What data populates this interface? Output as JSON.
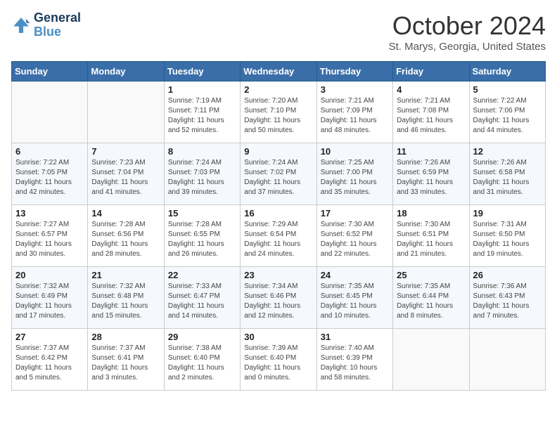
{
  "logo": {
    "line1": "General",
    "line2": "Blue"
  },
  "title": "October 2024",
  "subtitle": "St. Marys, Georgia, United States",
  "headers": [
    "Sunday",
    "Monday",
    "Tuesday",
    "Wednesday",
    "Thursday",
    "Friday",
    "Saturday"
  ],
  "weeks": [
    [
      {
        "day": "",
        "sunrise": "",
        "sunset": "",
        "daylight": ""
      },
      {
        "day": "",
        "sunrise": "",
        "sunset": "",
        "daylight": ""
      },
      {
        "day": "1",
        "sunrise": "Sunrise: 7:19 AM",
        "sunset": "Sunset: 7:11 PM",
        "daylight": "Daylight: 11 hours and 52 minutes."
      },
      {
        "day": "2",
        "sunrise": "Sunrise: 7:20 AM",
        "sunset": "Sunset: 7:10 PM",
        "daylight": "Daylight: 11 hours and 50 minutes."
      },
      {
        "day": "3",
        "sunrise": "Sunrise: 7:21 AM",
        "sunset": "Sunset: 7:09 PM",
        "daylight": "Daylight: 11 hours and 48 minutes."
      },
      {
        "day": "4",
        "sunrise": "Sunrise: 7:21 AM",
        "sunset": "Sunset: 7:08 PM",
        "daylight": "Daylight: 11 hours and 46 minutes."
      },
      {
        "day": "5",
        "sunrise": "Sunrise: 7:22 AM",
        "sunset": "Sunset: 7:06 PM",
        "daylight": "Daylight: 11 hours and 44 minutes."
      }
    ],
    [
      {
        "day": "6",
        "sunrise": "Sunrise: 7:22 AM",
        "sunset": "Sunset: 7:05 PM",
        "daylight": "Daylight: 11 hours and 42 minutes."
      },
      {
        "day": "7",
        "sunrise": "Sunrise: 7:23 AM",
        "sunset": "Sunset: 7:04 PM",
        "daylight": "Daylight: 11 hours and 41 minutes."
      },
      {
        "day": "8",
        "sunrise": "Sunrise: 7:24 AM",
        "sunset": "Sunset: 7:03 PM",
        "daylight": "Daylight: 11 hours and 39 minutes."
      },
      {
        "day": "9",
        "sunrise": "Sunrise: 7:24 AM",
        "sunset": "Sunset: 7:02 PM",
        "daylight": "Daylight: 11 hours and 37 minutes."
      },
      {
        "day": "10",
        "sunrise": "Sunrise: 7:25 AM",
        "sunset": "Sunset: 7:00 PM",
        "daylight": "Daylight: 11 hours and 35 minutes."
      },
      {
        "day": "11",
        "sunrise": "Sunrise: 7:26 AM",
        "sunset": "Sunset: 6:59 PM",
        "daylight": "Daylight: 11 hours and 33 minutes."
      },
      {
        "day": "12",
        "sunrise": "Sunrise: 7:26 AM",
        "sunset": "Sunset: 6:58 PM",
        "daylight": "Daylight: 11 hours and 31 minutes."
      }
    ],
    [
      {
        "day": "13",
        "sunrise": "Sunrise: 7:27 AM",
        "sunset": "Sunset: 6:57 PM",
        "daylight": "Daylight: 11 hours and 30 minutes."
      },
      {
        "day": "14",
        "sunrise": "Sunrise: 7:28 AM",
        "sunset": "Sunset: 6:56 PM",
        "daylight": "Daylight: 11 hours and 28 minutes."
      },
      {
        "day": "15",
        "sunrise": "Sunrise: 7:28 AM",
        "sunset": "Sunset: 6:55 PM",
        "daylight": "Daylight: 11 hours and 26 minutes."
      },
      {
        "day": "16",
        "sunrise": "Sunrise: 7:29 AM",
        "sunset": "Sunset: 6:54 PM",
        "daylight": "Daylight: 11 hours and 24 minutes."
      },
      {
        "day": "17",
        "sunrise": "Sunrise: 7:30 AM",
        "sunset": "Sunset: 6:52 PM",
        "daylight": "Daylight: 11 hours and 22 minutes."
      },
      {
        "day": "18",
        "sunrise": "Sunrise: 7:30 AM",
        "sunset": "Sunset: 6:51 PM",
        "daylight": "Daylight: 11 hours and 21 minutes."
      },
      {
        "day": "19",
        "sunrise": "Sunrise: 7:31 AM",
        "sunset": "Sunset: 6:50 PM",
        "daylight": "Daylight: 11 hours and 19 minutes."
      }
    ],
    [
      {
        "day": "20",
        "sunrise": "Sunrise: 7:32 AM",
        "sunset": "Sunset: 6:49 PM",
        "daylight": "Daylight: 11 hours and 17 minutes."
      },
      {
        "day": "21",
        "sunrise": "Sunrise: 7:32 AM",
        "sunset": "Sunset: 6:48 PM",
        "daylight": "Daylight: 11 hours and 15 minutes."
      },
      {
        "day": "22",
        "sunrise": "Sunrise: 7:33 AM",
        "sunset": "Sunset: 6:47 PM",
        "daylight": "Daylight: 11 hours and 14 minutes."
      },
      {
        "day": "23",
        "sunrise": "Sunrise: 7:34 AM",
        "sunset": "Sunset: 6:46 PM",
        "daylight": "Daylight: 11 hours and 12 minutes."
      },
      {
        "day": "24",
        "sunrise": "Sunrise: 7:35 AM",
        "sunset": "Sunset: 6:45 PM",
        "daylight": "Daylight: 11 hours and 10 minutes."
      },
      {
        "day": "25",
        "sunrise": "Sunrise: 7:35 AM",
        "sunset": "Sunset: 6:44 PM",
        "daylight": "Daylight: 11 hours and 8 minutes."
      },
      {
        "day": "26",
        "sunrise": "Sunrise: 7:36 AM",
        "sunset": "Sunset: 6:43 PM",
        "daylight": "Daylight: 11 hours and 7 minutes."
      }
    ],
    [
      {
        "day": "27",
        "sunrise": "Sunrise: 7:37 AM",
        "sunset": "Sunset: 6:42 PM",
        "daylight": "Daylight: 11 hours and 5 minutes."
      },
      {
        "day": "28",
        "sunrise": "Sunrise: 7:37 AM",
        "sunset": "Sunset: 6:41 PM",
        "daylight": "Daylight: 11 hours and 3 minutes."
      },
      {
        "day": "29",
        "sunrise": "Sunrise: 7:38 AM",
        "sunset": "Sunset: 6:40 PM",
        "daylight": "Daylight: 11 hours and 2 minutes."
      },
      {
        "day": "30",
        "sunrise": "Sunrise: 7:39 AM",
        "sunset": "Sunset: 6:40 PM",
        "daylight": "Daylight: 11 hours and 0 minutes."
      },
      {
        "day": "31",
        "sunrise": "Sunrise: 7:40 AM",
        "sunset": "Sunset: 6:39 PM",
        "daylight": "Daylight: 10 hours and 58 minutes."
      },
      {
        "day": "",
        "sunrise": "",
        "sunset": "",
        "daylight": ""
      },
      {
        "day": "",
        "sunrise": "",
        "sunset": "",
        "daylight": ""
      }
    ]
  ]
}
